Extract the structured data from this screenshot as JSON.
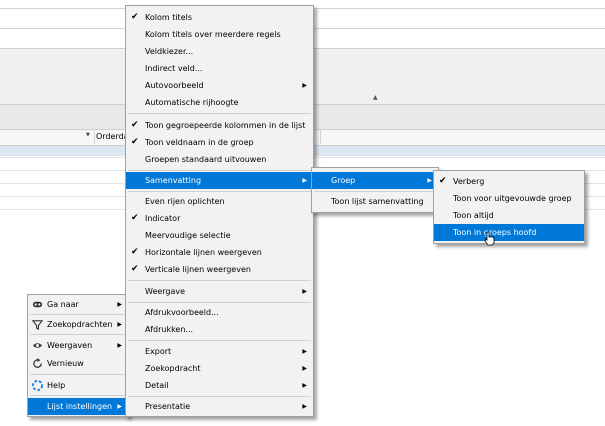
{
  "background": {
    "column_header": "Orderda",
    "sort_arrow": "▲"
  },
  "left_menu": {
    "items": [
      {
        "label": "Ga naar",
        "icon": "goto-icon",
        "submenu": true
      },
      {
        "label": "Zoekopdrachten",
        "icon": "filter-icon",
        "submenu": true
      },
      {
        "label": "Weergaven",
        "icon": "views-icon",
        "submenu": true
      },
      {
        "label": "Vernieuw",
        "icon": "refresh-icon",
        "submenu": false
      },
      {
        "label": "Help",
        "icon": "help-icon",
        "submenu": false
      },
      {
        "label": "Lijst instellingen",
        "icon": "",
        "submenu": true,
        "highlighted": true
      }
    ]
  },
  "main_menu": {
    "items": [
      {
        "label": "Kolom titels",
        "checked": true
      },
      {
        "label": "Kolom titels over meerdere regels",
        "checked": false
      },
      {
        "label": "Veldkiezer...",
        "checked": false
      },
      {
        "label": "Indirect veld...",
        "checked": false
      },
      {
        "label": "Autovoorbeeld",
        "checked": false,
        "submenu": true
      },
      {
        "label": "Automatische rijhoogte",
        "checked": false
      },
      {
        "label": "Toon gegroepeerde kolommen in de lijst",
        "checked": true
      },
      {
        "label": "Toon veldnaam in de groep",
        "checked": true
      },
      {
        "label": "Groepen standaard uitvouwen",
        "checked": false
      },
      {
        "label": "Samenvatting",
        "checked": false,
        "submenu": true,
        "highlighted": true
      },
      {
        "label": "Even rijen oplichten",
        "checked": false
      },
      {
        "label": "Indicator",
        "checked": true
      },
      {
        "label": "Meervoudige selectie",
        "checked": false
      },
      {
        "label": "Horizontale lijnen weergeven",
        "checked": true
      },
      {
        "label": "Verticale lijnen weergeven",
        "checked": true
      },
      {
        "label": "Weergave",
        "checked": false,
        "submenu": true
      },
      {
        "label": "Afdrukvoorbeeld...",
        "checked": false
      },
      {
        "label": "Afdrukken...",
        "checked": false
      },
      {
        "label": "Export",
        "checked": false,
        "submenu": true
      },
      {
        "label": "Zoekopdracht",
        "checked": false,
        "submenu": true
      },
      {
        "label": "Detail",
        "checked": false,
        "submenu": true
      },
      {
        "label": "Presentatie",
        "checked": false,
        "submenu": true
      }
    ]
  },
  "summary_menu": {
    "items": [
      {
        "label": "Groep",
        "submenu": true,
        "highlighted": true
      },
      {
        "label": "Toon lijst samenvatting",
        "submenu": false
      }
    ]
  },
  "group_menu": {
    "items": [
      {
        "label": "Verberg",
        "checked": true
      },
      {
        "label": "Toon voor uitgevouwde groep",
        "checked": false
      },
      {
        "label": "Toon altijd",
        "checked": false
      },
      {
        "label": "Toon in groeps hoofd",
        "checked": false,
        "highlighted": true
      }
    ]
  },
  "glyphs": {
    "check": "✔",
    "submenu_arrow": "▶"
  },
  "colors": {
    "highlight": "#0078d7",
    "menu_bg": "#f2f2f2"
  }
}
